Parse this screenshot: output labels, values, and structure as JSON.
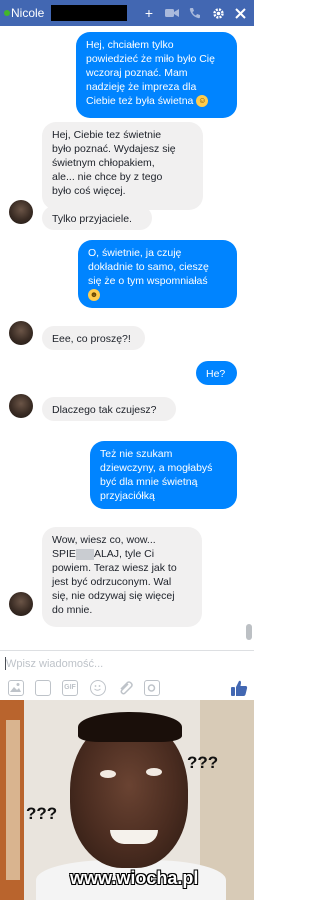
{
  "header": {
    "contact_name": "Nicole",
    "icons": [
      "plus-icon",
      "video-icon",
      "phone-icon",
      "gear-icon",
      "close-icon"
    ]
  },
  "colors": {
    "header_bg": "#4267b2",
    "outgoing_bubble": "#0084ff",
    "incoming_bubble": "#f1f0f0",
    "online_dot": "#42b72a"
  },
  "messages": [
    {
      "dir": "out",
      "text": "Hej, chciałem tylko\npowiedzieć że miło było Cię\nwczoraj poznać. Mam\nnadzieję że impreza dla\nCiebie też była świetna"
    },
    {
      "dir": "in",
      "text": "Hej, Ciebie tez świetnie\nbyło poznać. Wydajesz się\nświetnym chłopakiem,\nale... nie chce by z tego\nbyło coś więcej."
    },
    {
      "dir": "in",
      "text": "Tylko przyjaciele."
    },
    {
      "dir": "out",
      "text": "O, świetnie, ja czuję\ndokładnie to samo, cieszę\nsię że o tym wspomniałaś"
    },
    {
      "dir": "in",
      "text": "Eee, co proszę?!"
    },
    {
      "dir": "out",
      "text": "He?"
    },
    {
      "dir": "in",
      "text": "Dlaczego tak czujesz?"
    },
    {
      "dir": "out",
      "text": "Też nie szukam\ndziewczyny, a mogłabyś\nbyć dla mnie świetną\nprzyjaciółką"
    },
    {
      "dir": "in",
      "text_a": "Wow, wiesz co, wow...\nSPIE",
      "text_b": "ALAJ, tyle Ci\npowiem. Teraz wiesz jak to\njest być odrzuconym. Wal\nsię, nie odzywaj się więcej\ndo mnie."
    }
  ],
  "composer": {
    "placeholder": "Wpisz wiadomość...",
    "tools": [
      "photo-icon",
      "sticker-icon",
      "gif-icon",
      "emoji-icon",
      "attachment-icon",
      "camera-icon"
    ],
    "gif_label": "GIF"
  },
  "meme": {
    "question_left": "???",
    "question_right": "???",
    "watermark": "www.wiocha.pl"
  }
}
